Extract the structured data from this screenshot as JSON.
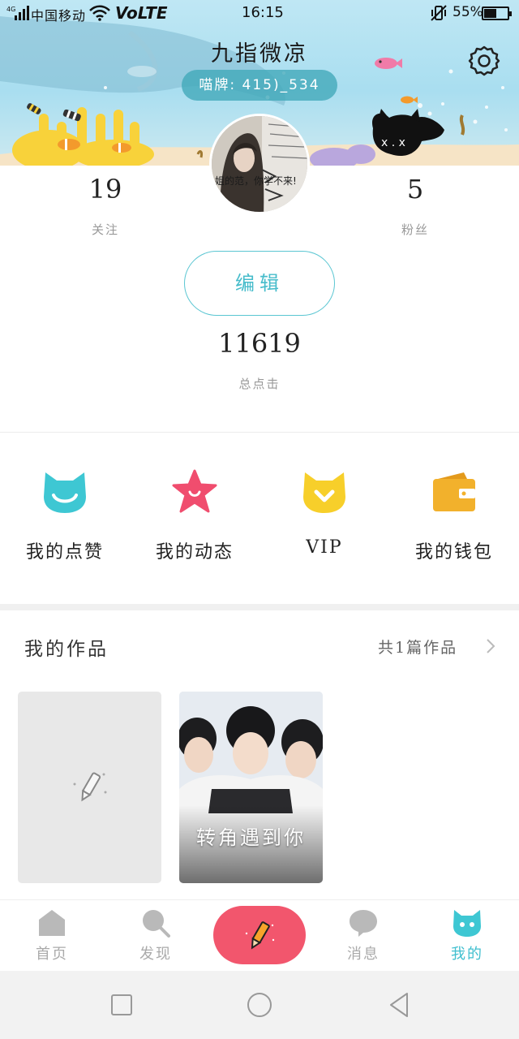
{
  "status_bar": {
    "signal_label": "4G",
    "carrier": "中国移动",
    "network": "VoLTE",
    "time": "16:15",
    "battery_percent": "55%",
    "battery_level": 0.55
  },
  "profile": {
    "name": "九指微凉",
    "id_label": "喵牌: 415)_534"
  },
  "avatar_caption": "姐的范，你学不来!",
  "stats": {
    "following_count": "19",
    "following_label": "关注",
    "followers_count": "5",
    "followers_label": "粉丝",
    "edit_label": "编辑",
    "clicks_count": "11619",
    "clicks_label": "总点击"
  },
  "menu": [
    {
      "label": "我的点赞",
      "icon": "cat-smile-icon",
      "color": "#3ec7d3"
    },
    {
      "label": "我的动态",
      "icon": "star-icon",
      "color": "#f04d6e"
    },
    {
      "label": "VIP",
      "icon": "vip-cat-icon",
      "color": "#f7cf2a"
    },
    {
      "label": "我的钱包",
      "icon": "wallet-icon",
      "color": "#f2b12c"
    }
  ],
  "works": {
    "title": "我的作品",
    "count_label": "共1篇作品",
    "items": [
      {
        "title": "转角遇到你"
      }
    ]
  },
  "tabbar": {
    "tabs": [
      {
        "label": "首页",
        "icon": "home-icon"
      },
      {
        "label": "发现",
        "icon": "search-icon"
      },
      {
        "label": "消息",
        "icon": "message-icon"
      },
      {
        "label": "我的",
        "icon": "cat-profile-icon"
      }
    ],
    "active": "我的"
  },
  "colors": {
    "accent": "#3fbfcf",
    "compose": "#f2566d",
    "banner_sky": "#b6e3f2"
  }
}
